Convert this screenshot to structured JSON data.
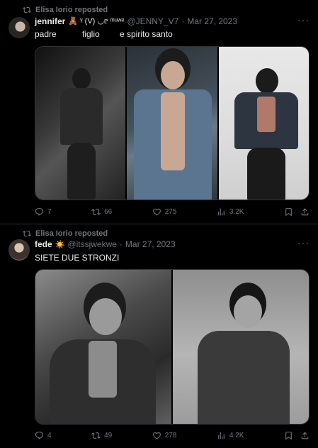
{
  "tweets": [
    {
      "reposted_by": "Elisa Iorio reposted",
      "name": "jennifer",
      "emoji": "🧸 ᵞ (V) ◡ᥱ ᵐᵘʷᵉ",
      "handle": "@JENNY_V7",
      "dot": "·",
      "date": "Mar 27, 2023",
      "text_parts": [
        "padre",
        "figlio",
        "e spirito santo"
      ],
      "replies": "7",
      "reposts": "66",
      "likes": "275",
      "views": "3.2K"
    },
    {
      "reposted_by": "Elisa Iorio reposted",
      "name": "fede",
      "emoji": "☀️",
      "handle": "@itssjwekwe",
      "dot": "·",
      "date": "Mar 27, 2023",
      "text": "SIETE DUE STRONZI",
      "replies": "4",
      "reposts": "49",
      "likes": "278",
      "views": "4.2K"
    }
  ],
  "more_label": "···",
  "icons": [
    "repost-icon",
    "reply-icon",
    "retweet-icon",
    "like-icon",
    "views-icon",
    "bookmark-icon",
    "share-icon",
    "more-icon"
  ],
  "colors": {
    "background": "#000000",
    "text": "#e7e9ea",
    "muted": "#71767b",
    "border": "#2f3336"
  }
}
